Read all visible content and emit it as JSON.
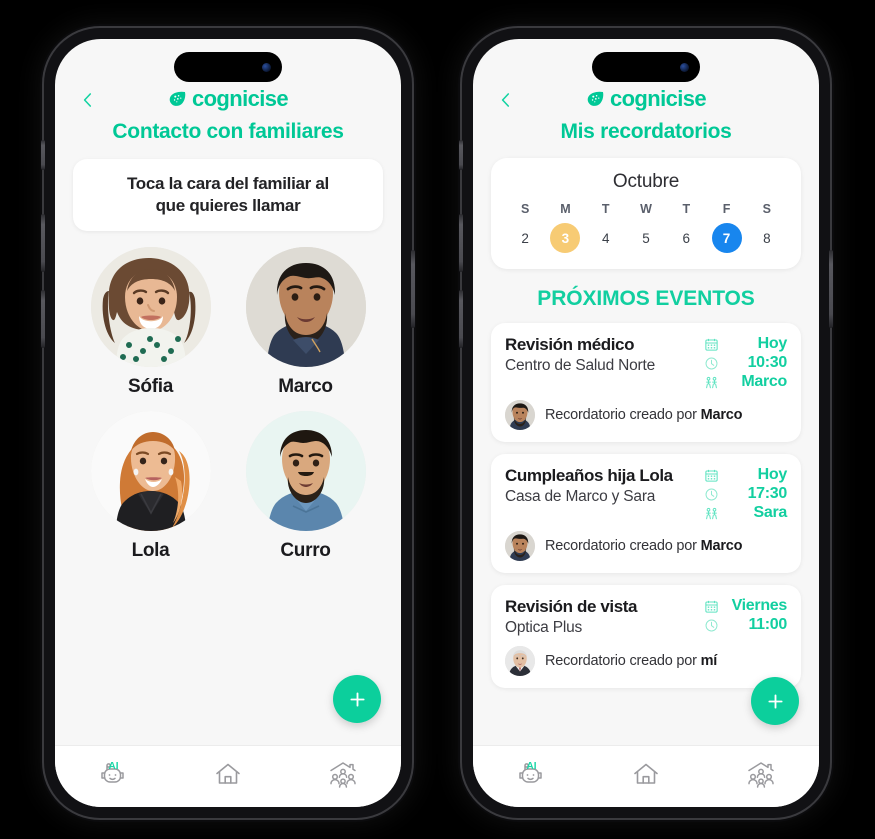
{
  "brand": {
    "name": "cognicise",
    "accent": "#00c896",
    "accent_alt": "#12cfa0"
  },
  "phone_left": {
    "header": {
      "back_icon": "chevron-left-icon",
      "logo_text": "cognicise",
      "page_title": "Contacto con familiares"
    },
    "hint_card": {
      "line1": "Toca la cara del familiar al",
      "line2": "que quieres llamar"
    },
    "contacts": [
      {
        "name": "Sófia"
      },
      {
        "name": "Marco"
      },
      {
        "name": "Lola"
      },
      {
        "name": "Curro"
      }
    ],
    "fab": {
      "icon": "plus-icon",
      "label": "+"
    },
    "tabs": [
      {
        "name": "ai-assistant",
        "badge": "AI"
      },
      {
        "name": "home",
        "badge": ""
      },
      {
        "name": "family",
        "badge": ""
      }
    ]
  },
  "phone_right": {
    "header": {
      "back_icon": "chevron-left-icon",
      "logo_text": "cognicise",
      "page_title": "Mis recordatorios"
    },
    "calendar": {
      "month": "Octubre",
      "dow": [
        "S",
        "M",
        "T",
        "W",
        "T",
        "F",
        "S"
      ],
      "days": [
        {
          "n": "2",
          "state": ""
        },
        {
          "n": "3",
          "state": "amber"
        },
        {
          "n": "4",
          "state": ""
        },
        {
          "n": "5",
          "state": ""
        },
        {
          "n": "6",
          "state": ""
        },
        {
          "n": "7",
          "state": "blue"
        },
        {
          "n": "8",
          "state": ""
        }
      ],
      "colors": {
        "amber": "#f7cb74",
        "blue": "#1886ee"
      }
    },
    "section_title": "PRÓXIMOS EVENTOS",
    "events": [
      {
        "title": "Revisión médico",
        "place": "Centro de Salud Norte",
        "day": "Hoy",
        "time": "10:30",
        "person": "Marco",
        "created_prefix": "Recordatorio creado por",
        "created_by": "Marco",
        "has_person_row": true,
        "has_footer": true
      },
      {
        "title": "Cumpleaños hija Lola",
        "place": "Casa de Marco y Sara",
        "day": "Hoy",
        "time": "17:30",
        "person": "Sara",
        "created_prefix": "Recordatorio creado por",
        "created_by": "Marco",
        "has_person_row": true,
        "has_footer": true
      },
      {
        "title": "Revisión de vista",
        "place": "Optica Plus",
        "day": "Viernes",
        "time": "11:00",
        "person": "",
        "created_prefix": "Recordatorio creado por",
        "created_by": "mí",
        "has_person_row": false,
        "has_footer": true
      }
    ],
    "fab": {
      "icon": "plus-icon",
      "label": "+"
    },
    "tabs": [
      {
        "name": "ai-assistant",
        "badge": "AI"
      },
      {
        "name": "home",
        "badge": ""
      },
      {
        "name": "family",
        "badge": ""
      }
    ]
  }
}
